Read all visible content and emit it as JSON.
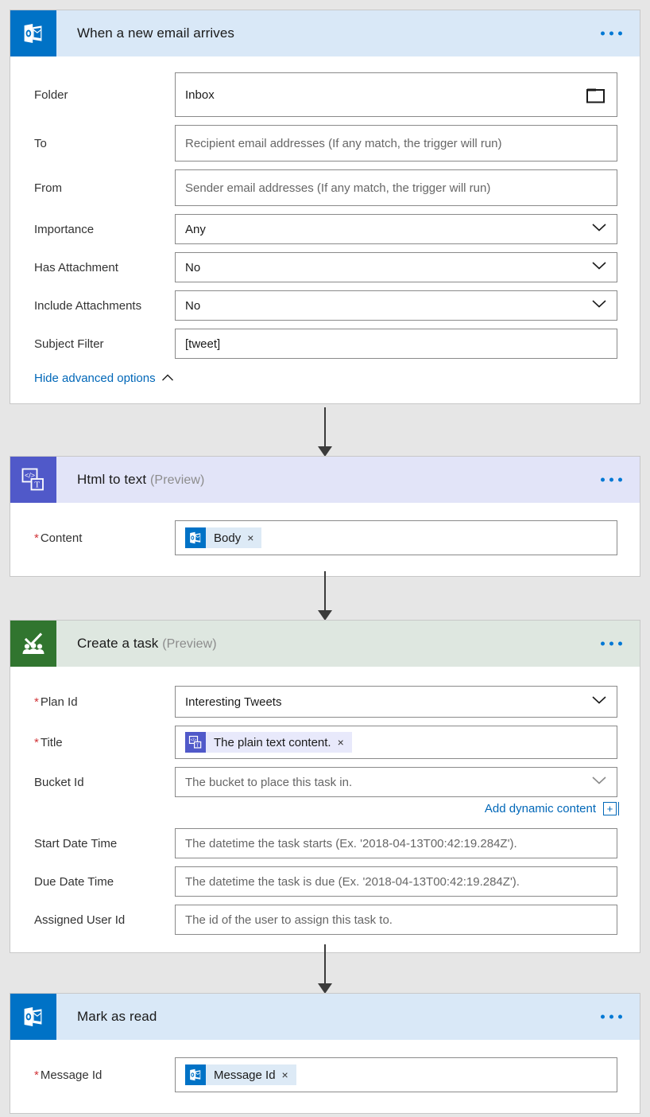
{
  "flow": {
    "steps": [
      {
        "id": "trigger-new-email",
        "title": "When a new email arrives",
        "preview_label": "",
        "icon": "outlook-icon",
        "header_color": "#d9e8f7",
        "icon_color": "#0072c6",
        "menu_icon": "ellipsis-icon",
        "fields": [
          {
            "label": "Folder",
            "required": false,
            "type": "text-with-picker",
            "value": "Inbox",
            "placeholder": "",
            "trailing_icon": "folder-icon"
          },
          {
            "label": "To",
            "required": false,
            "type": "text",
            "value": "",
            "placeholder": "Recipient email addresses (If any match, the trigger will run)"
          },
          {
            "label": "From",
            "required": false,
            "type": "text",
            "value": "",
            "placeholder": "Sender email addresses (If any match, the trigger will run)"
          },
          {
            "label": "Importance",
            "required": false,
            "type": "select",
            "value": "Any",
            "placeholder": "",
            "trailing_icon": "chevron-down-icon"
          },
          {
            "label": "Has Attachment",
            "required": false,
            "type": "select",
            "value": "No",
            "placeholder": "",
            "trailing_icon": "chevron-down-icon"
          },
          {
            "label": "Include Attachments",
            "required": false,
            "type": "select",
            "value": "No",
            "placeholder": "",
            "trailing_icon": "chevron-down-icon"
          },
          {
            "label": "Subject Filter",
            "required": false,
            "type": "text",
            "value": "[tweet]",
            "placeholder": ""
          }
        ],
        "advanced_link": "Hide advanced options",
        "advanced_chevron": "chevron-up-icon"
      },
      {
        "id": "action-html-to-text",
        "title": "Html to text",
        "preview_label": "(Preview)",
        "icon": "html-to-text-icon",
        "header_color": "#e2e4f8",
        "icon_color": "#5059c9",
        "menu_icon": "ellipsis-icon",
        "fields": [
          {
            "label": "Content",
            "required": true,
            "type": "token",
            "token_text": "Body",
            "token_icon": "outlook-icon",
            "token_color": "#ddeaf6",
            "token_remove": "×"
          }
        ]
      },
      {
        "id": "action-create-task",
        "title": "Create a task",
        "preview_label": "(Preview)",
        "icon": "planner-icon",
        "header_color": "#dee7e0",
        "icon_color": "#31752f",
        "menu_icon": "ellipsis-icon",
        "fields": [
          {
            "label": "Plan Id",
            "required": true,
            "type": "select",
            "value": "Interesting Tweets",
            "placeholder": "",
            "trailing_icon": "chevron-down-icon"
          },
          {
            "label": "Title",
            "required": true,
            "type": "token",
            "token_text": "The plain text content.",
            "token_icon": "html-to-text-icon",
            "token_color": "#e8e9fb",
            "token_remove": "×"
          },
          {
            "label": "Bucket Id",
            "required": false,
            "type": "select",
            "value": "",
            "placeholder": "The bucket to place this task in.",
            "trailing_icon": "chevron-down-icon"
          },
          {
            "label": "Start Date Time",
            "required": false,
            "type": "text",
            "value": "",
            "placeholder": "The datetime the task starts (Ex. '2018-04-13T00:42:19.284Z')."
          },
          {
            "label": "Due Date Time",
            "required": false,
            "type": "text",
            "value": "",
            "placeholder": "The datetime the task is due (Ex. '2018-04-13T00:42:19.284Z')."
          },
          {
            "label": "Assigned User Id",
            "required": false,
            "type": "text",
            "value": "",
            "placeholder": "The id of the user to assign this task to."
          }
        ],
        "dynamic_content_link": "Add dynamic content",
        "dynamic_content_icon": "add-plus-icon"
      },
      {
        "id": "action-mark-as-read",
        "title": "Mark as read",
        "preview_label": "",
        "icon": "outlook-icon",
        "header_color": "#d9e8f7",
        "icon_color": "#0072c6",
        "menu_icon": "ellipsis-icon",
        "fields": [
          {
            "label": "Message Id",
            "required": true,
            "type": "token",
            "token_text": "Message Id",
            "token_icon": "outlook-icon",
            "token_color": "#ddeaf6",
            "token_remove": "×"
          }
        ]
      }
    ],
    "connectors": [
      {
        "from": "trigger-new-email",
        "to": "action-html-to-text",
        "icon": "arrow-down-icon"
      },
      {
        "from": "action-html-to-text",
        "to": "action-create-task",
        "icon": "arrow-down-icon"
      },
      {
        "from": "action-create-task",
        "to": "action-mark-as-read",
        "icon": "arrow-down-icon"
      }
    ],
    "colors": {
      "canvas_background": "#e6e6e6",
      "card_background": "#ffffff",
      "link": "#0067b8",
      "accent": "#0078d4",
      "required_marker": "#d13438",
      "connector": "#3b3b3b"
    }
  }
}
